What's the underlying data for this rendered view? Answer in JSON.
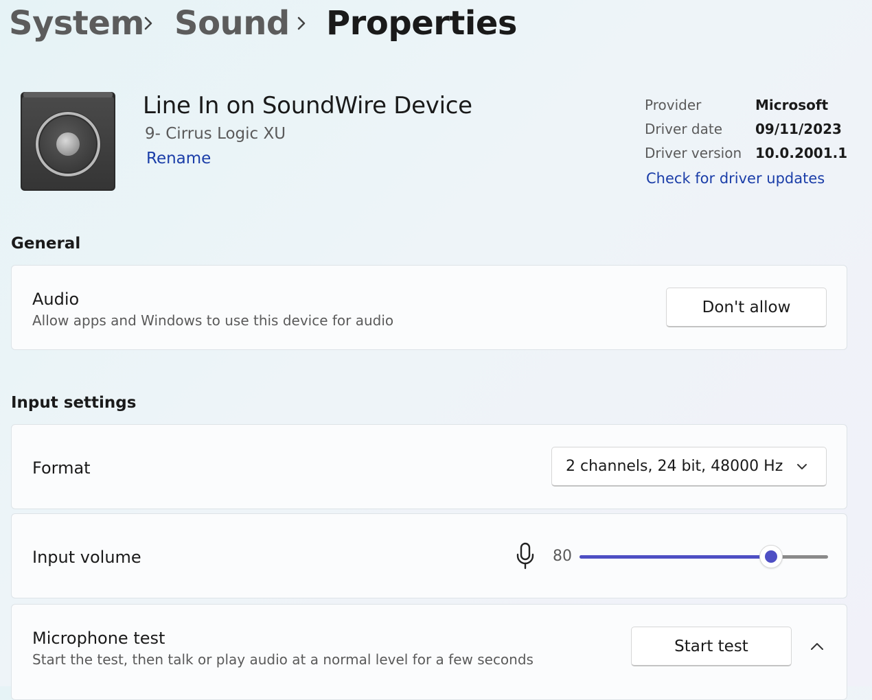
{
  "breadcrumb": {
    "items": [
      "System",
      "Sound",
      "Properties"
    ]
  },
  "device": {
    "name": "Line In on SoundWire Device",
    "subtitle": "9- Cirrus Logic XU",
    "rename_label": "Rename",
    "icon": "speaker-icon"
  },
  "driver": {
    "provider_label": "Provider",
    "provider_value": "Microsoft",
    "date_label": "Driver date",
    "date_value": "09/11/2023",
    "version_label": "Driver version",
    "version_value": "10.0.2001.1",
    "update_link": "Check for driver updates"
  },
  "general": {
    "title": "General",
    "audio": {
      "title": "Audio",
      "description": "Allow apps and Windows to use this device for audio",
      "button_label": "Don't allow"
    }
  },
  "input_settings": {
    "title": "Input settings",
    "format": {
      "title": "Format",
      "selected": "2 channels, 24 bit, 48000 Hz"
    },
    "input_volume": {
      "title": "Input volume",
      "value": "80",
      "level_fraction": 0.8,
      "icon": "microphone-icon"
    },
    "mic_test": {
      "title": "Microphone test",
      "description": "Start the test, then talk or play audio at a normal level for a few seconds",
      "button_label": "Start test"
    }
  },
  "colors": {
    "accent": "#4e4fc4",
    "link": "#1a3da8",
    "track_inactive": "#8a8a8a"
  }
}
